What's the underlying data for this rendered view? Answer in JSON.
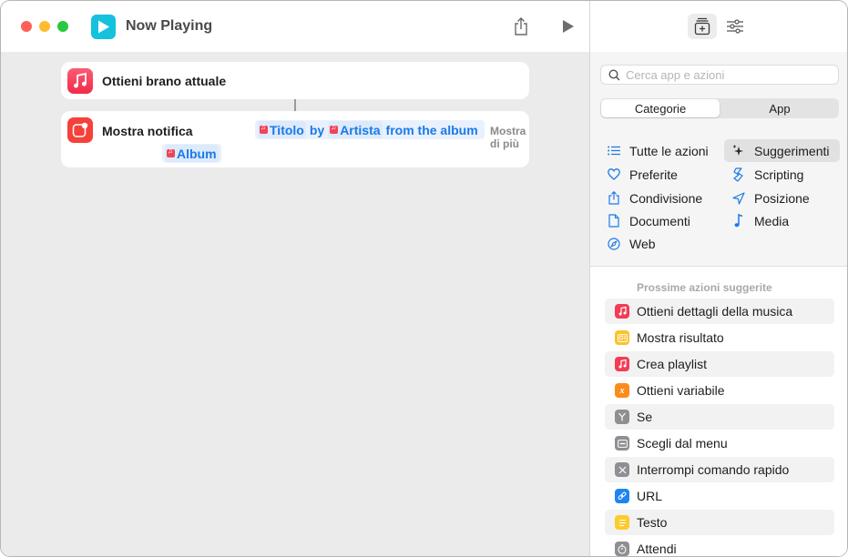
{
  "window": {
    "title": "Now Playing",
    "app_icon": "play-icon",
    "app_icon_color": "#14c2dd"
  },
  "toolbar": {
    "share_icon": "share-icon",
    "run_icon": "play-icon",
    "library_icon": "action-library-icon",
    "settings_icon": "sliders-icon"
  },
  "editor": {
    "actions": [
      {
        "label": "Ottieni brano attuale",
        "icon": "music-note-icon",
        "icon_color": "#f22b4a"
      },
      {
        "label": "Mostra notifica",
        "icon": "notification-icon",
        "icon_color": "#f5413a",
        "tokens": [
          {
            "type": "variable",
            "label": "Titolo"
          },
          {
            "type": "text",
            "label": "by"
          },
          {
            "type": "variable",
            "label": "Artista"
          },
          {
            "type": "text",
            "label": "from the album"
          },
          {
            "type": "variable",
            "label": "Album"
          }
        ],
        "more_label": "Mostra di più"
      }
    ]
  },
  "sidebar": {
    "search_placeholder": "Cerca app e azioni",
    "segments": [
      {
        "label": "Categorie",
        "active": true
      },
      {
        "label": "App",
        "active": false
      }
    ],
    "categories": [
      {
        "label": "Tutte le azioni",
        "icon": "list-icon"
      },
      {
        "label": "Suggerimenti",
        "icon": "sparkle-icon",
        "selected": true
      },
      {
        "label": "Preferite",
        "icon": "heart-icon"
      },
      {
        "label": "Scripting",
        "icon": "scripting-icon"
      },
      {
        "label": "Condivisione",
        "icon": "share-icon"
      },
      {
        "label": "Posizione",
        "icon": "location-arrow-icon"
      },
      {
        "label": "Documenti",
        "icon": "document-icon"
      },
      {
        "label": "Media",
        "icon": "music-note-icon"
      },
      {
        "label": "Web",
        "icon": "compass-icon"
      }
    ],
    "suggestions_header": "Prossime azioni suggerite",
    "suggestions": [
      {
        "label": "Ottieni dettagli della musica",
        "icon": "music-note-icon",
        "color": "#f43c55"
      },
      {
        "label": "Mostra risultato",
        "icon": "result-icon",
        "color": "#fcc22b"
      },
      {
        "label": "Crea playlist",
        "icon": "music-note-icon",
        "color": "#f43c55"
      },
      {
        "label": "Ottieni variabile",
        "icon": "variable-icon",
        "color": "#fb8c1c"
      },
      {
        "label": "Se",
        "icon": "branch-icon",
        "color": "#8e8e93"
      },
      {
        "label": "Scegli dal menu",
        "icon": "menu-icon",
        "color": "#8e8e93"
      },
      {
        "label": "Interrompi comando rapido",
        "icon": "stop-x-icon",
        "color": "#8e8e93"
      },
      {
        "label": "URL",
        "icon": "link-icon",
        "color": "#1f84f2"
      },
      {
        "label": "Testo",
        "icon": "text-icon",
        "color": "#fdcb2c"
      },
      {
        "label": "Attendi",
        "icon": "timer-icon",
        "color": "#8e8e93"
      }
    ]
  }
}
